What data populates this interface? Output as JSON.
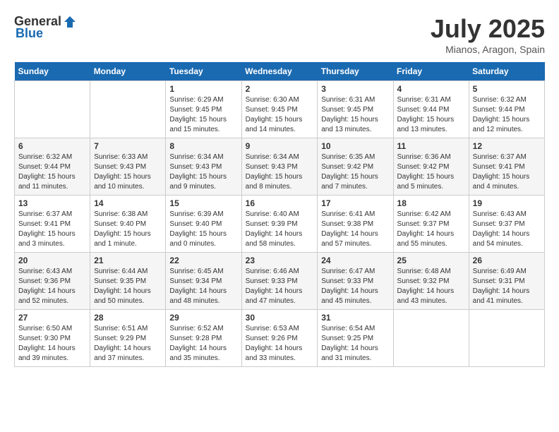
{
  "header": {
    "logo_general": "General",
    "logo_blue": "Blue",
    "month_title": "July 2025",
    "location": "Mianos, Aragon, Spain"
  },
  "days_of_week": [
    "Sunday",
    "Monday",
    "Tuesday",
    "Wednesday",
    "Thursday",
    "Friday",
    "Saturday"
  ],
  "weeks": [
    [
      {
        "day": "",
        "empty": true
      },
      {
        "day": "",
        "empty": true
      },
      {
        "day": "1",
        "sunrise": "Sunrise: 6:29 AM",
        "sunset": "Sunset: 9:45 PM",
        "daylight": "Daylight: 15 hours and 15 minutes."
      },
      {
        "day": "2",
        "sunrise": "Sunrise: 6:30 AM",
        "sunset": "Sunset: 9:45 PM",
        "daylight": "Daylight: 15 hours and 14 minutes."
      },
      {
        "day": "3",
        "sunrise": "Sunrise: 6:31 AM",
        "sunset": "Sunset: 9:45 PM",
        "daylight": "Daylight: 15 hours and 13 minutes."
      },
      {
        "day": "4",
        "sunrise": "Sunrise: 6:31 AM",
        "sunset": "Sunset: 9:44 PM",
        "daylight": "Daylight: 15 hours and 13 minutes."
      },
      {
        "day": "5",
        "sunrise": "Sunrise: 6:32 AM",
        "sunset": "Sunset: 9:44 PM",
        "daylight": "Daylight: 15 hours and 12 minutes."
      }
    ],
    [
      {
        "day": "6",
        "sunrise": "Sunrise: 6:32 AM",
        "sunset": "Sunset: 9:44 PM",
        "daylight": "Daylight: 15 hours and 11 minutes."
      },
      {
        "day": "7",
        "sunrise": "Sunrise: 6:33 AM",
        "sunset": "Sunset: 9:43 PM",
        "daylight": "Daylight: 15 hours and 10 minutes."
      },
      {
        "day": "8",
        "sunrise": "Sunrise: 6:34 AM",
        "sunset": "Sunset: 9:43 PM",
        "daylight": "Daylight: 15 hours and 9 minutes."
      },
      {
        "day": "9",
        "sunrise": "Sunrise: 6:34 AM",
        "sunset": "Sunset: 9:43 PM",
        "daylight": "Daylight: 15 hours and 8 minutes."
      },
      {
        "day": "10",
        "sunrise": "Sunrise: 6:35 AM",
        "sunset": "Sunset: 9:42 PM",
        "daylight": "Daylight: 15 hours and 7 minutes."
      },
      {
        "day": "11",
        "sunrise": "Sunrise: 6:36 AM",
        "sunset": "Sunset: 9:42 PM",
        "daylight": "Daylight: 15 hours and 5 minutes."
      },
      {
        "day": "12",
        "sunrise": "Sunrise: 6:37 AM",
        "sunset": "Sunset: 9:41 PM",
        "daylight": "Daylight: 15 hours and 4 minutes."
      }
    ],
    [
      {
        "day": "13",
        "sunrise": "Sunrise: 6:37 AM",
        "sunset": "Sunset: 9:41 PM",
        "daylight": "Daylight: 15 hours and 3 minutes."
      },
      {
        "day": "14",
        "sunrise": "Sunrise: 6:38 AM",
        "sunset": "Sunset: 9:40 PM",
        "daylight": "Daylight: 15 hours and 1 minute."
      },
      {
        "day": "15",
        "sunrise": "Sunrise: 6:39 AM",
        "sunset": "Sunset: 9:40 PM",
        "daylight": "Daylight: 15 hours and 0 minutes."
      },
      {
        "day": "16",
        "sunrise": "Sunrise: 6:40 AM",
        "sunset": "Sunset: 9:39 PM",
        "daylight": "Daylight: 14 hours and 58 minutes."
      },
      {
        "day": "17",
        "sunrise": "Sunrise: 6:41 AM",
        "sunset": "Sunset: 9:38 PM",
        "daylight": "Daylight: 14 hours and 57 minutes."
      },
      {
        "day": "18",
        "sunrise": "Sunrise: 6:42 AM",
        "sunset": "Sunset: 9:37 PM",
        "daylight": "Daylight: 14 hours and 55 minutes."
      },
      {
        "day": "19",
        "sunrise": "Sunrise: 6:43 AM",
        "sunset": "Sunset: 9:37 PM",
        "daylight": "Daylight: 14 hours and 54 minutes."
      }
    ],
    [
      {
        "day": "20",
        "sunrise": "Sunrise: 6:43 AM",
        "sunset": "Sunset: 9:36 PM",
        "daylight": "Daylight: 14 hours and 52 minutes."
      },
      {
        "day": "21",
        "sunrise": "Sunrise: 6:44 AM",
        "sunset": "Sunset: 9:35 PM",
        "daylight": "Daylight: 14 hours and 50 minutes."
      },
      {
        "day": "22",
        "sunrise": "Sunrise: 6:45 AM",
        "sunset": "Sunset: 9:34 PM",
        "daylight": "Daylight: 14 hours and 48 minutes."
      },
      {
        "day": "23",
        "sunrise": "Sunrise: 6:46 AM",
        "sunset": "Sunset: 9:33 PM",
        "daylight": "Daylight: 14 hours and 47 minutes."
      },
      {
        "day": "24",
        "sunrise": "Sunrise: 6:47 AM",
        "sunset": "Sunset: 9:33 PM",
        "daylight": "Daylight: 14 hours and 45 minutes."
      },
      {
        "day": "25",
        "sunrise": "Sunrise: 6:48 AM",
        "sunset": "Sunset: 9:32 PM",
        "daylight": "Daylight: 14 hours and 43 minutes."
      },
      {
        "day": "26",
        "sunrise": "Sunrise: 6:49 AM",
        "sunset": "Sunset: 9:31 PM",
        "daylight": "Daylight: 14 hours and 41 minutes."
      }
    ],
    [
      {
        "day": "27",
        "sunrise": "Sunrise: 6:50 AM",
        "sunset": "Sunset: 9:30 PM",
        "daylight": "Daylight: 14 hours and 39 minutes."
      },
      {
        "day": "28",
        "sunrise": "Sunrise: 6:51 AM",
        "sunset": "Sunset: 9:29 PM",
        "daylight": "Daylight: 14 hours and 37 minutes."
      },
      {
        "day": "29",
        "sunrise": "Sunrise: 6:52 AM",
        "sunset": "Sunset: 9:28 PM",
        "daylight": "Daylight: 14 hours and 35 minutes."
      },
      {
        "day": "30",
        "sunrise": "Sunrise: 6:53 AM",
        "sunset": "Sunset: 9:26 PM",
        "daylight": "Daylight: 14 hours and 33 minutes."
      },
      {
        "day": "31",
        "sunrise": "Sunrise: 6:54 AM",
        "sunset": "Sunset: 9:25 PM",
        "daylight": "Daylight: 14 hours and 31 minutes."
      },
      {
        "day": "",
        "empty": true
      },
      {
        "day": "",
        "empty": true
      }
    ]
  ]
}
